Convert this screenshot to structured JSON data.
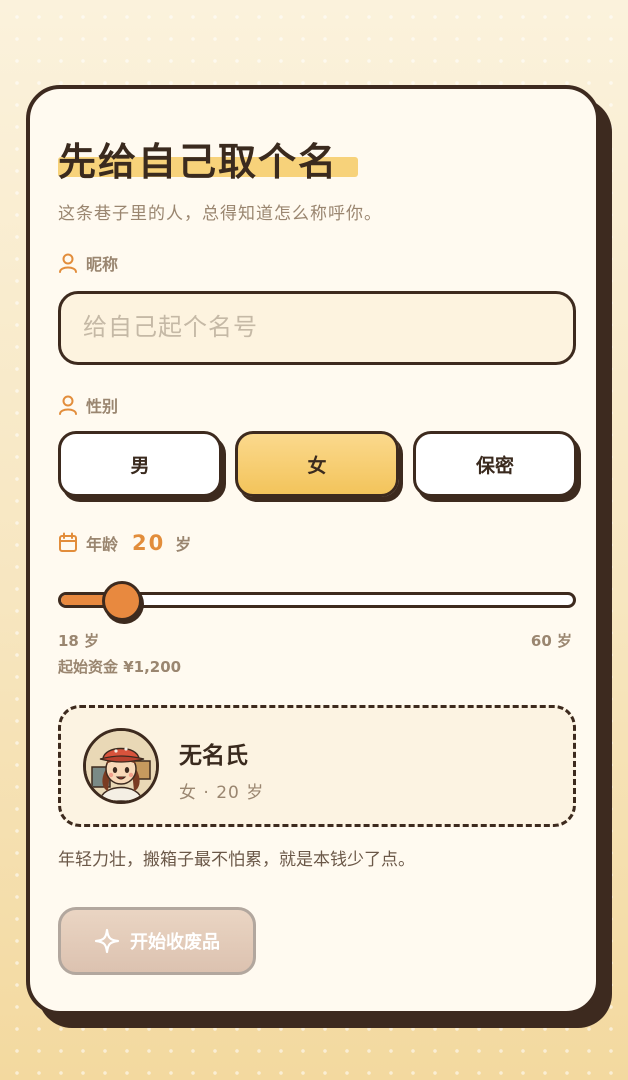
{
  "header": {
    "title": "先给自己取个名",
    "subtitle": "这条巷子里的人，总得知道怎么称呼你。"
  },
  "nickname": {
    "label": "昵称",
    "placeholder": "给自己起个名号",
    "value": ""
  },
  "gender": {
    "label": "性别",
    "options": [
      "男",
      "女",
      "保密"
    ],
    "selected": "女"
  },
  "age": {
    "label": "年龄",
    "value": "20",
    "unit": "岁",
    "min_label": "18 岁",
    "max_label": "60 岁",
    "min": 18,
    "max": 60,
    "current": 20,
    "funds": "起始资金 ¥1,200"
  },
  "preview": {
    "name": "无名氏",
    "meta": "女 · 20 岁",
    "avatar_icon": "avatar-icon"
  },
  "description": "年轻力壮，搬箱子最不怕累，就是本钱少了点。",
  "actions": {
    "start_label": "开始收废品",
    "start_icon": "sparkle-icon",
    "start_enabled": false
  },
  "colors": {
    "accent_orange": "#e8893f",
    "selected_yellow": "#f3c45b",
    "outline_brown": "#3d2a1f",
    "card_bg": "#fffaf0"
  }
}
